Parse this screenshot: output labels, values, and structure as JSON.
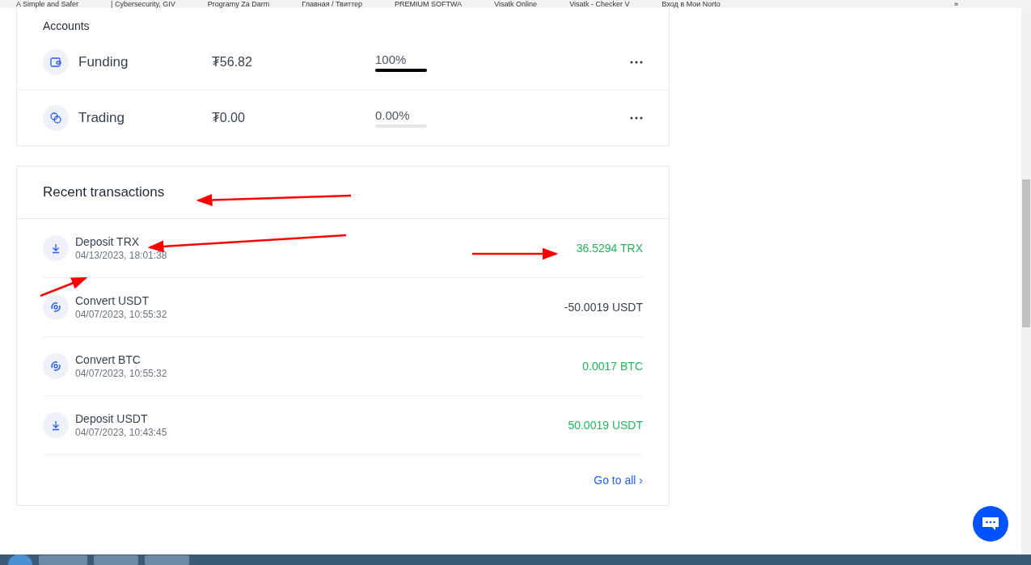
{
  "bookmarks": [
    {
      "label": "A Simple and Safer"
    },
    {
      "label": "| Cybersecurity, GIV"
    },
    {
      "label": "Programy Za Darm"
    },
    {
      "label": "Главная / Твиттер"
    },
    {
      "label": "PREMIUM SOFTWA"
    },
    {
      "label": "Visatk Online"
    },
    {
      "label": "Visatk - Checker V"
    },
    {
      "label": "Вход в Мои Norto"
    }
  ],
  "bookmarks_more": "»",
  "accounts": {
    "title": "Accounts",
    "rows": [
      {
        "kind": "funding",
        "name": "Funding",
        "balance": "₮56.82",
        "share": "100%",
        "level": 1
      },
      {
        "kind": "trading",
        "name": "Trading",
        "balance": "₮0.00",
        "share": "0.00%",
        "level": 0
      }
    ]
  },
  "transactions": {
    "title": "Recent transactions",
    "rows": [
      {
        "kind": "deposit",
        "title": "Deposit TRX",
        "time": "04/13/2023, 18:01:38",
        "amount": "36.5294 TRX",
        "positive": true
      },
      {
        "kind": "convert",
        "title": "Convert USDT",
        "time": "04/07/2023, 10:55:32",
        "amount": "-50.0019 USDT",
        "positive": false
      },
      {
        "kind": "convert",
        "title": "Convert BTC",
        "time": "04/07/2023, 10:55:32",
        "amount": "0.0017 BTC",
        "positive": true
      },
      {
        "kind": "deposit",
        "title": "Deposit USDT",
        "time": "04/07/2023, 10:43:45",
        "amount": "50.0019 USDT",
        "positive": true
      }
    ],
    "link": "Go to all ›"
  }
}
